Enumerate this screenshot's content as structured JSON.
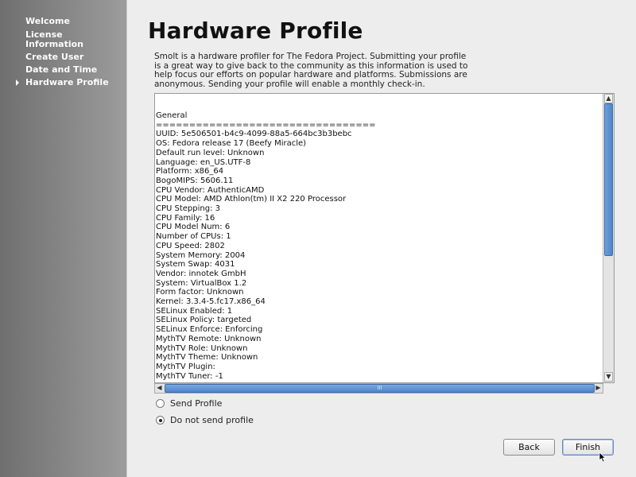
{
  "sidebar": {
    "steps": [
      {
        "label": "Welcome"
      },
      {
        "label": "License\nInformation"
      },
      {
        "label": "Create User"
      },
      {
        "label": "Date and Time"
      },
      {
        "label": "Hardware Profile"
      }
    ]
  },
  "page": {
    "title": "Hardware Profile",
    "intro": "Smolt is a hardware profiler for The Fedora Project.  Submitting your profile is a great way to give back to the community as this information is used to help focus our efforts on popular hardware and platforms.  Submissions are anonymous.  Sending your profile will enable a monthly check-in."
  },
  "profile_lines": [
    "General",
    "=================================",
    "UUID: 5e506501-b4c9-4099-88a5-664bc3b3bebc",
    "OS: Fedora release 17 (Beefy Miracle)",
    "Default run level: Unknown",
    "Language: en_US.UTF-8",
    "Platform: x86_64",
    "BogoMIPS: 5606.11",
    "CPU Vendor: AuthenticAMD",
    "CPU Model: AMD Athlon(tm) II X2 220 Processor",
    "CPU Stepping: 3",
    "CPU Family: 16",
    "CPU Model Num: 6",
    "Number of CPUs: 1",
    "CPU Speed: 2802",
    "System Memory: 2004",
    "System Swap: 4031",
    "Vendor: innotek GmbH",
    "System: VirtualBox 1.2",
    "Form factor: Unknown",
    "Kernel: 3.3.4-5.fc17.x86_64",
    "SELinux Enabled: 1",
    "SELinux Policy: targeted",
    "SELinux Enforce: Enforcing",
    "MythTV Remote: Unknown",
    "MythTV Role: Unknown",
    "MythTV Theme: Unknown",
    "MythTV Plugin:",
    "MythTV Tuner: -1"
  ],
  "options": {
    "send_label": "Send Profile",
    "no_send_label": "Do not send profile",
    "selected": "no_send"
  },
  "buttons": {
    "back": "Back",
    "finish": "Finish"
  },
  "scrollbar": {
    "h_grip": "III",
    "up_arrow": "▲",
    "down_arrow": "▼",
    "left_arrow": "◀",
    "right_arrow": "▶"
  }
}
